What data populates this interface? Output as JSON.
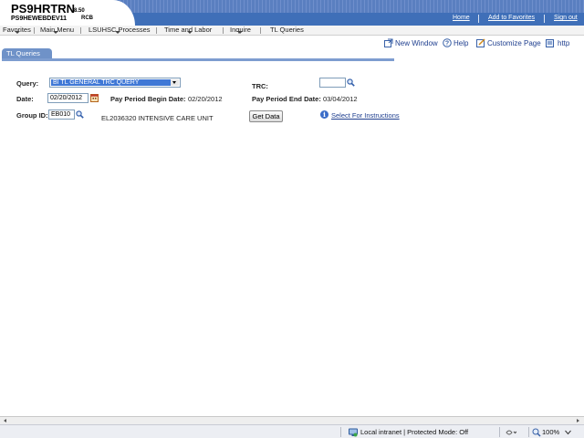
{
  "header": {
    "app_name": "PS9HRTRN",
    "version": "8.50",
    "database": "PS9HEWEBDEV11",
    "user": "RCB",
    "links": [
      "Home",
      "Add to Favorites",
      "Sign out"
    ]
  },
  "menu": {
    "items": [
      "Favorites",
      "Main Menu",
      "LSUHSC Processes",
      "Time and Labor",
      "Inquire",
      "TL Queries"
    ]
  },
  "page_links": {
    "new_window": "New Window",
    "help": "Help",
    "customize_page": "Customize Page",
    "http": "http"
  },
  "tab": {
    "label": "TL Queries"
  },
  "form": {
    "query_label": "Query:",
    "query_value": "BI TL GENERAL TRC QUERY",
    "trc_label": "TRC:",
    "trc_value": "",
    "date_label": "Date:",
    "date_value": "02/20/2012",
    "pp_begin_label": "Pay Period Begin Date:",
    "pp_begin_value": "02/20/2012",
    "pp_end_label": "Pay Period End Date:",
    "pp_end_value": "03/04/2012",
    "group_label": "Group ID:",
    "group_value": "EB010",
    "group_desc": "EL2036320 INTENSIVE CARE UNIT",
    "get_data_label": "Get Data",
    "instructions_link": "Select For Instructions"
  },
  "statusbar": {
    "zone": "Local intranet | Protected Mode: Off",
    "zoom": "100%"
  },
  "colors": {
    "header_blue": "#3f6fb8",
    "tab_blue": "#6f92c8",
    "link_blue": "#1f3f8f",
    "selection_blue": "#3f78d6"
  }
}
